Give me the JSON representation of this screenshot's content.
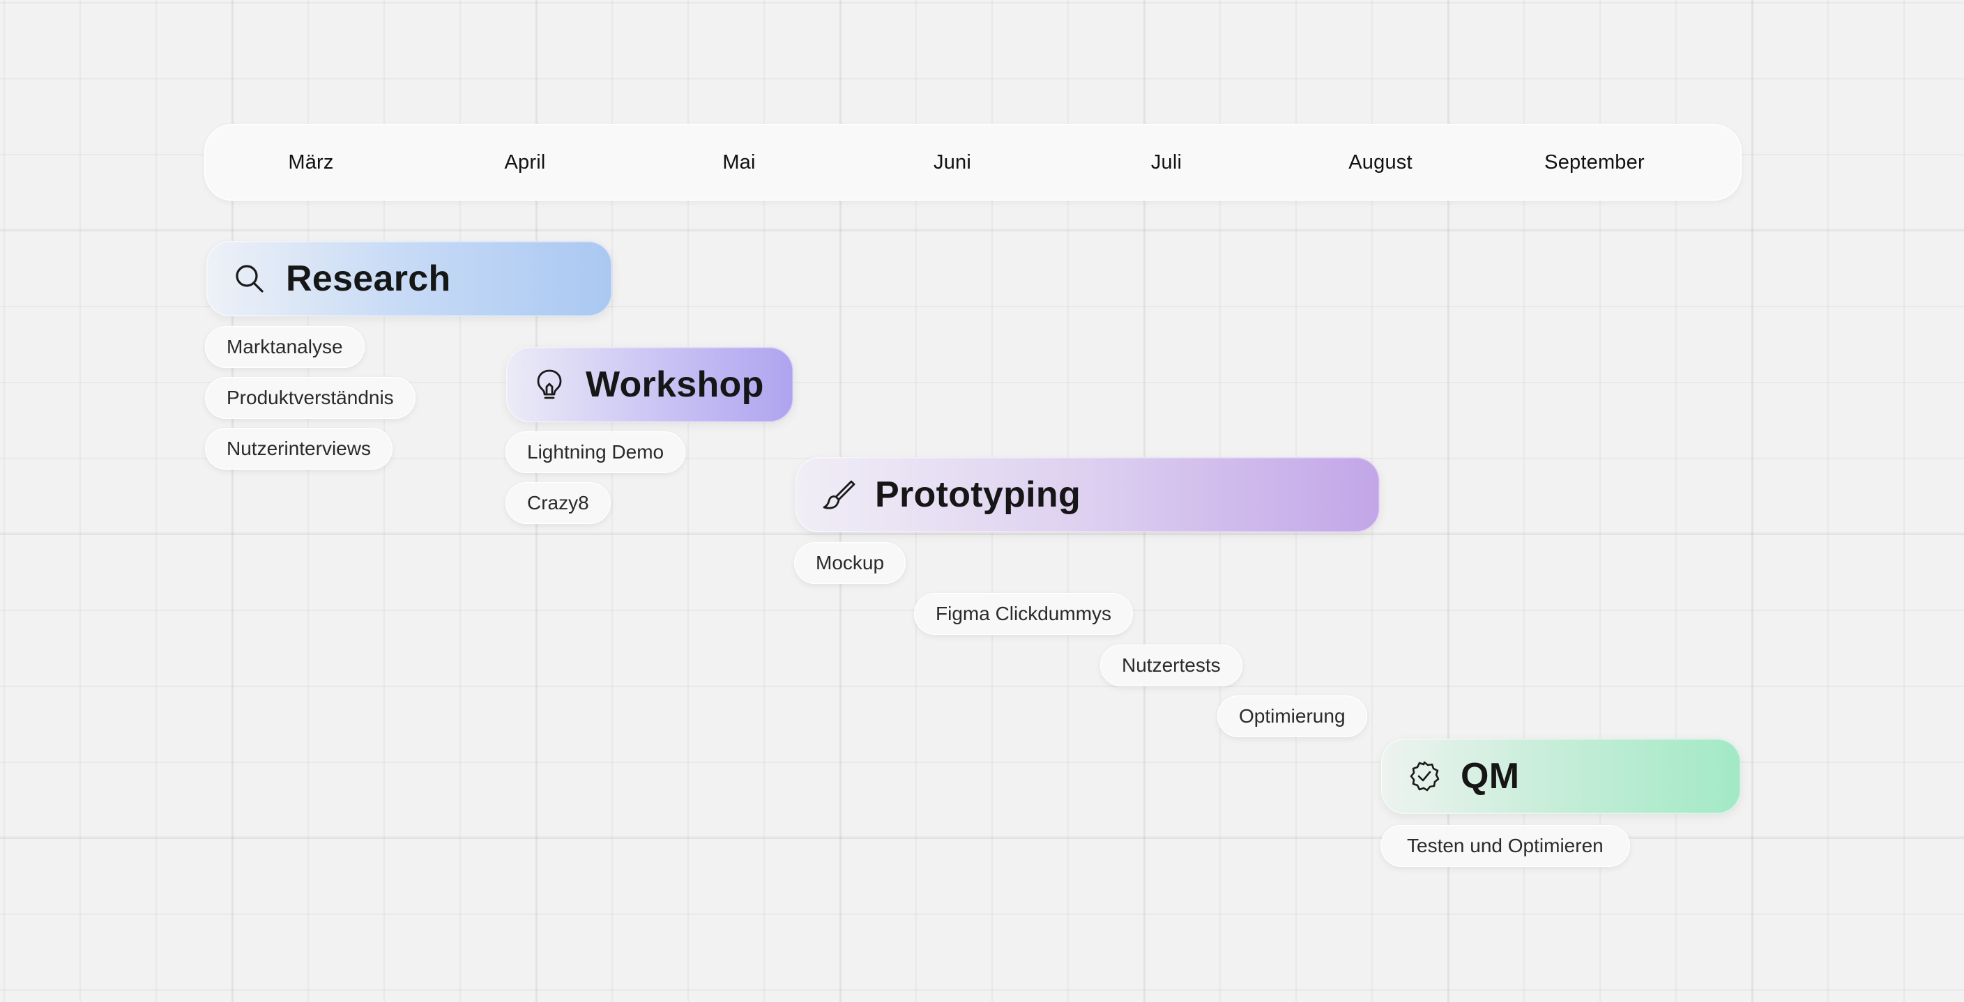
{
  "months": [
    "März",
    "April",
    "Mai",
    "Juni",
    "Juli",
    "August",
    "September"
  ],
  "phases": {
    "research": {
      "title": "Research",
      "icon": "search-icon",
      "color": "#aac8f2",
      "tasks": [
        "Marktanalyse",
        "Produktverständnis",
        "Nutzerinterviews"
      ]
    },
    "workshop": {
      "title": "Workshop",
      "icon": "lightbulb-icon",
      "color": "#aea4ef",
      "tasks": [
        "Lightning Demo",
        "Crazy8"
      ]
    },
    "prototyping": {
      "title": "Prototyping",
      "icon": "paintbrush-icon",
      "color": "#c2a6e8",
      "tasks": [
        "Mockup",
        "Figma Clickdummys",
        "Nutzertests",
        "Optimierung"
      ]
    },
    "qm": {
      "title": "QM",
      "icon": "check-badge-icon",
      "color": "#a2e9c6",
      "tasks": [
        "Testen und Optimieren"
      ]
    }
  }
}
